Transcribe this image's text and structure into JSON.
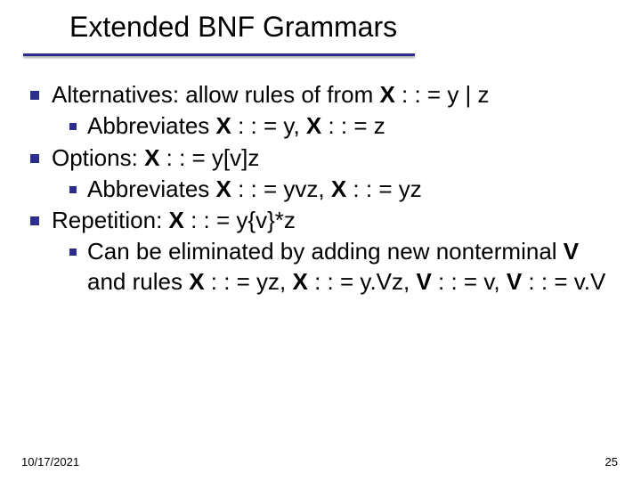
{
  "title": "Extended BNF Grammars",
  "bullets": [
    {
      "segments": [
        {
          "t": "Alternatives: allow rules of from "
        },
        {
          "t": "X",
          "b": true
        },
        {
          "t": " : : = y | z"
        }
      ],
      "children": [
        {
          "segments": [
            {
              "t": "Abbreviates  "
            },
            {
              "t": "X",
              "b": true
            },
            {
              "t": " : : = y, "
            },
            {
              "t": "X",
              "b": true
            },
            {
              "t": " : : = z"
            }
          ]
        }
      ]
    },
    {
      "segments": [
        {
          "t": "Options:  "
        },
        {
          "t": "X",
          "b": true
        },
        {
          "t": " : : = y[v]z"
        }
      ],
      "children": [
        {
          "segments": [
            {
              "t": "Abbreviates "
            },
            {
              "t": "X",
              "b": true
            },
            {
              "t": " : : = yvz, "
            },
            {
              "t": "X",
              "b": true
            },
            {
              "t": " : : = yz"
            }
          ]
        }
      ]
    },
    {
      "segments": [
        {
          "t": "Repetition: "
        },
        {
          "t": "X",
          "b": true
        },
        {
          "t": " : : = y{v}*z"
        }
      ],
      "children": [
        {
          "segments": [
            {
              "t": "Can be eliminated by adding new nonterminal "
            },
            {
              "t": "V",
              "b": true
            },
            {
              "t": " and rules "
            },
            {
              "t": "X",
              "b": true
            },
            {
              "t": " : : = yz, "
            },
            {
              "t": "X",
              "b": true
            },
            {
              "t": " : : = y.Vz, "
            },
            {
              "t": "V",
              "b": true
            },
            {
              "t": " : : = v, "
            },
            {
              "t": "V",
              "b": true
            },
            {
              "t": " : : = v.V"
            }
          ]
        }
      ]
    }
  ],
  "footer": {
    "date": "10/17/2021",
    "page": "25"
  }
}
